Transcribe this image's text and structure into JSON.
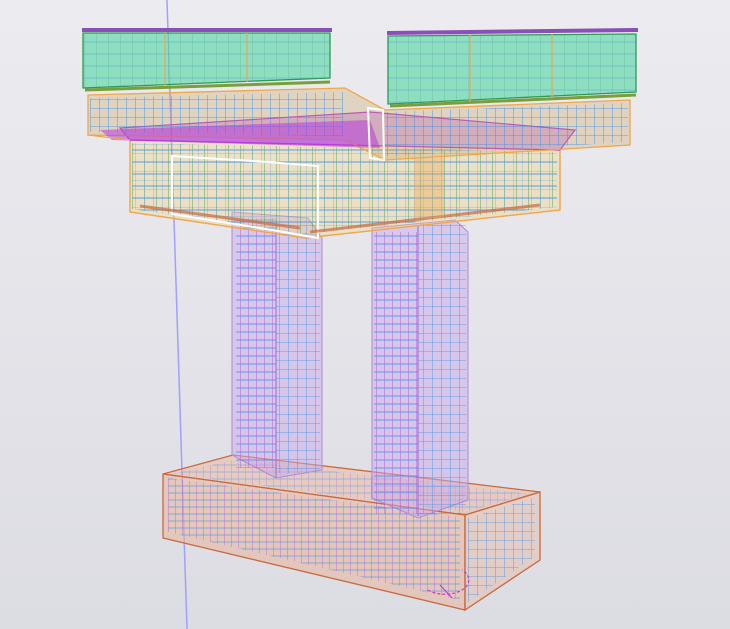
{
  "view": {
    "colors": {
      "background": "#e6e6eb",
      "grid_line": "#a0a0ff",
      "concrete_outline": "#f0a64a",
      "rebar_blue": "#3a8fe6",
      "rebar_green": "#2f9a54",
      "rebar_magenta": "#b43cdc",
      "column_fill": "#c9a9e9",
      "barrier_fill": "#6fd9b2",
      "barrier_top": "#8a4fb8",
      "footing_fill": "#e8b49a",
      "footing_outline": "#c86a40",
      "deck_fill": "#c9a35a",
      "white_frame": "#ffffff"
    },
    "icons": [
      "rotation-gizmo-icon"
    ]
  }
}
